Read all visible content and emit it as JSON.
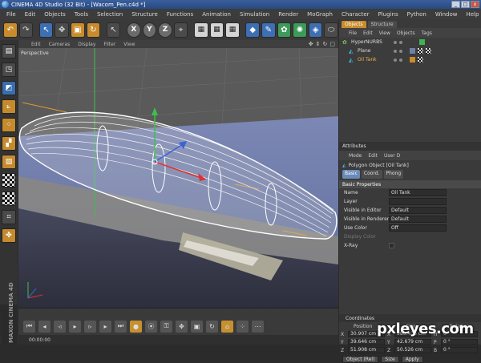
{
  "window": {
    "title": "CINEMA 4D Studio (32 Bit) - [Wacom_Pen.c4d *]",
    "controls": [
      "_",
      "□",
      "x"
    ]
  },
  "menu": [
    "File",
    "Edit",
    "Objects",
    "Tools",
    "Selection",
    "Structure",
    "Functions",
    "Animation",
    "Simulation",
    "Render",
    "MoGraph",
    "Character",
    "Plugins",
    "Python",
    "Window",
    "Help"
  ],
  "toolbar": {
    "icons": [
      "undo-icon",
      "redo-icon",
      "select-icon",
      "move-icon",
      "scale-icon",
      "rotate-icon",
      "last-tool-icon",
      "x-axis-icon",
      "y-axis-icon",
      "z-axis-icon",
      "coord-system-icon",
      "render-view-icon",
      "render-picture-viewer-icon",
      "render-settings-icon",
      "cube-icon",
      "spline-icon",
      "nurbs-icon",
      "array-icon",
      "deformer-icon",
      "scene-icon",
      "light-icon"
    ],
    "axis_labels": [
      "X",
      "Y",
      "Z"
    ]
  },
  "viewport": {
    "menu": [
      "Edit",
      "Cameras",
      "Display",
      "Filter",
      "View"
    ],
    "label": "Perspective",
    "nav": [
      "✥",
      "⇕",
      "↻",
      "▢"
    ]
  },
  "objects_panel": {
    "tabs": [
      "Objects",
      "Structure"
    ],
    "active_tab": "Objects",
    "menu": [
      "File",
      "Edit",
      "View",
      "Objects",
      "Tags"
    ],
    "items": [
      {
        "name": "HyperNURBS",
        "selected": false
      },
      {
        "name": "Plane",
        "selected": false
      },
      {
        "name": "Oil Tank",
        "selected": true
      }
    ]
  },
  "attributes_panel": {
    "title": "Attributes",
    "menu": [
      "Mode",
      "Edit",
      "User D"
    ],
    "object_label": "Polygon Object [Oil Tank]",
    "tabs": [
      "Basic",
      "Coord.",
      "Phong"
    ],
    "active_tab": "Basic",
    "section": "Basic Properties",
    "props": [
      {
        "label": "Name",
        "value": "Oil Tank",
        "dim": false
      },
      {
        "label": "Layer",
        "value": "",
        "dim": false
      },
      {
        "label": "Visible in Editor",
        "value": "Default",
        "dim": false
      },
      {
        "label": "Visible in Renderer",
        "value": "Default",
        "dim": false
      },
      {
        "label": "Use Color",
        "value": "Off",
        "dim": false
      },
      {
        "label": "Display Color",
        "value": "",
        "dim": true
      },
      {
        "label": "X-Ray",
        "value": "",
        "dim": false
      }
    ]
  },
  "coordinates_panel": {
    "title": "Coordinates",
    "columns": [
      "Position",
      "Size",
      "Rotation"
    ],
    "rows": [
      {
        "axis": "X",
        "position": "30.907 cm",
        "size_axis": "X",
        "size": "580.436 cm",
        "rot_axis": "H",
        "rotation": "0 °"
      },
      {
        "axis": "Y",
        "position": "39.646 cm",
        "size_axis": "Y",
        "size": "42.679 cm",
        "rot_axis": "P",
        "rotation": "0 °"
      },
      {
        "axis": "Z",
        "position": "51.908 cm",
        "size_axis": "Z",
        "size": "50.526 cm",
        "rot_axis": "B",
        "rotation": "0 °"
      }
    ],
    "mode_select": "Object (Rel)",
    "size_select": "Size",
    "apply_label": "Apply"
  },
  "status": {
    "time": "00:00:00"
  },
  "branding": {
    "vertical_logo": "MAXON CINEMA 4D",
    "watermark": "pxleyes.com"
  }
}
